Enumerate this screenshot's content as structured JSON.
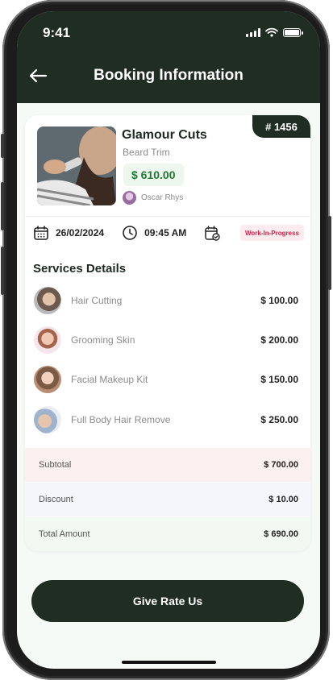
{
  "status_bar": {
    "time": "9:41"
  },
  "header": {
    "title": "Booking Information"
  },
  "booking": {
    "id": "# 1456",
    "shop_name": "Glamour Cuts",
    "service": "Beard Trim",
    "price": "$ 610.00",
    "barber": "Oscar Rhys",
    "date": "26/02/2024",
    "time": "09:45 AM",
    "status": "Work-In-Progress"
  },
  "services_section": {
    "title": "Services Details",
    "items": [
      {
        "name": "Hair Cutting",
        "amount": "$ 100.00"
      },
      {
        "name": "Grooming Skin",
        "amount": "$ 200.00"
      },
      {
        "name": "Facial Makeup Kit",
        "amount": "$ 150.00"
      },
      {
        "name": "Full Body Hair Remove",
        "amount": "$ 250.00"
      }
    ]
  },
  "summary": {
    "subtotal_label": "Subtotal",
    "subtotal": "$ 700.00",
    "discount_label": "Discount",
    "discount": "$ 10.00",
    "total_label": "Total Amount",
    "total": "$ 690.00"
  },
  "actions": {
    "rate_label": "Give Rate Us"
  },
  "colors": {
    "primary": "#1f2d22",
    "price": "#1e7a35",
    "status": "#d71d46"
  },
  "icons": [
    "back-arrow-icon",
    "calendar-icon",
    "clock-icon",
    "calendar-check-icon",
    "signal-icon",
    "wifi-icon",
    "battery-icon"
  ]
}
